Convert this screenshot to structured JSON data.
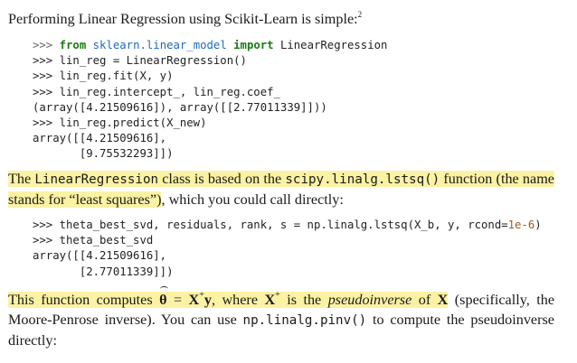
{
  "intro": {
    "text": "Performing Linear Regression using Scikit-Learn is simple:",
    "footnote": "2"
  },
  "code1": {
    "l1_prompt": ">>>",
    "l1_from": "from",
    "l1_module": "sklearn.linear_model",
    "l1_import": "import",
    "l1_name": "LinearRegression",
    "l2": ">>> lin_reg = LinearRegression()",
    "l3": ">>> lin_reg.fit(X, y)",
    "l4": ">>> lin_reg.intercept_, lin_reg.coef_",
    "l5": "(array([4.21509616]), array([[2.77011339]]))",
    "l6": ">>> lin_reg.predict(X_new)",
    "l7": "array([[4.21509616],",
    "l8": "       [9.75532293]])"
  },
  "para1": {
    "t1": "The ",
    "c1": "LinearRegression",
    "t2": " class is based on the ",
    "c2": "scipy.linalg.lstsq()",
    "t3": " function (the name stands for “least squares”)",
    "t4": ", which you could call directly:"
  },
  "code2": {
    "l1_a": ">>> theta_best_svd, residuals, rank, s = np.linalg.lstsq(X_b, y, rcond=",
    "l1_num": "1e-6",
    "l1_b": ")",
    "l2": ">>> theta_best_svd",
    "l3": "array([[4.21509616],",
    "l4": "       [2.77011339]])"
  },
  "para2": {
    "t1": "This function computes ",
    "theta": "θ",
    "eq": " = ",
    "X1": "X",
    "plus1": "+",
    "y": "y",
    "t2": ", where ",
    "X2": "X",
    "plus2": "+",
    "t3": " is the ",
    "pinv_term": "pseudoinverse",
    "t4": " of ",
    "X3": "X",
    "t5": " (specifically, the Moore-Penrose inverse). You can use ",
    "c1": "np.linalg.pinv()",
    "t6": " to compute the pseudoinverse directly:"
  }
}
